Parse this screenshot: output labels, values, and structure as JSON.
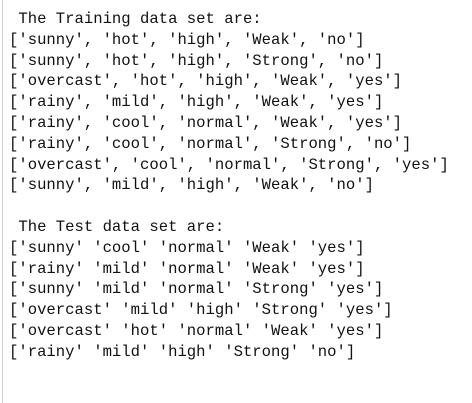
{
  "output": {
    "training_title": " The Training data set are:",
    "training_rows": [
      "['sunny', 'hot', 'high', 'Weak', 'no']",
      "['sunny', 'hot', 'high', 'Strong', 'no']",
      "['overcast', 'hot', 'high', 'Weak', 'yes']",
      "['rainy', 'mild', 'high', 'Weak', 'yes']",
      "['rainy', 'cool', 'normal', 'Weak', 'yes']",
      "['rainy', 'cool', 'normal', 'Strong', 'no']",
      "['overcast', 'cool', 'normal', 'Strong', 'yes']",
      "['sunny', 'mild', 'high', 'Weak', 'no']"
    ],
    "test_title": " The Test data set are:",
    "test_rows": [
      "['sunny' 'cool' 'normal' 'Weak' 'yes']",
      "['rainy' 'mild' 'normal' 'Weak' 'yes']",
      "['sunny' 'mild' 'normal' 'Strong' 'yes']",
      "['overcast' 'mild' 'high' 'Strong' 'yes']",
      "['overcast' 'hot' 'normal' 'Weak' 'yes']",
      "['rainy' 'mild' 'high' 'Strong' 'no']"
    ]
  }
}
